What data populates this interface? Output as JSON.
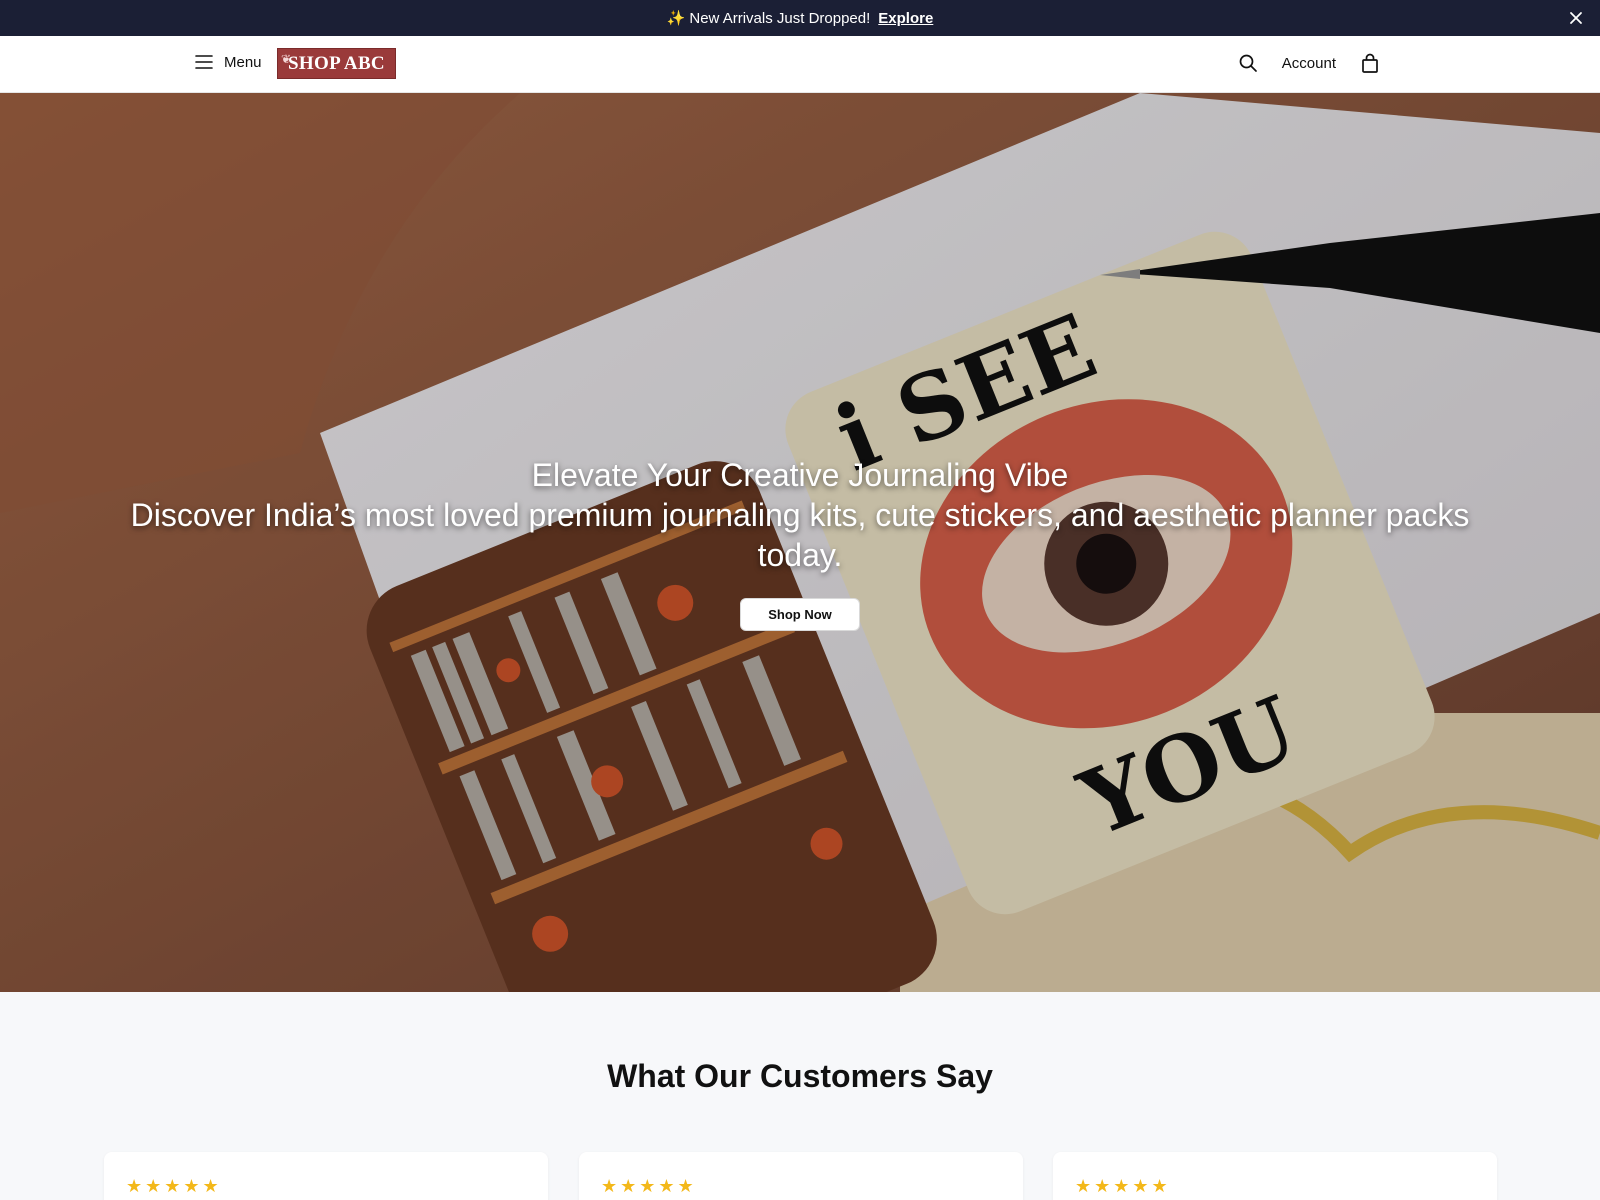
{
  "announcement": {
    "text": "New Arrivals Just Dropped!",
    "link_label": "Explore"
  },
  "header": {
    "menu_label": "Menu",
    "logo_text": "SHOP ABC",
    "account_label": "Account"
  },
  "hero": {
    "title": "Elevate Your Creative Journaling Vibe",
    "subtitle": "Discover India’s most loved premium journaling kits, cute stickers, and aesthetic planner packs today.",
    "cta_label": "Shop Now"
  },
  "testimonials": {
    "title": "What Our Customers Say",
    "cards": [
      {
        "stars": "★★★★★",
        "rating": 5
      },
      {
        "stars": "★★★★★",
        "rating": 5
      },
      {
        "stars": "★★★★★",
        "rating": 5
      }
    ]
  },
  "colors": {
    "announcement_bg": "#1b1f35",
    "logo_bg": "#9a3a3a",
    "star": "#f3b81a"
  },
  "icons": [
    "sparkle-icon",
    "close-icon",
    "hamburger-icon",
    "search-icon",
    "bag-icon",
    "star-icon"
  ]
}
